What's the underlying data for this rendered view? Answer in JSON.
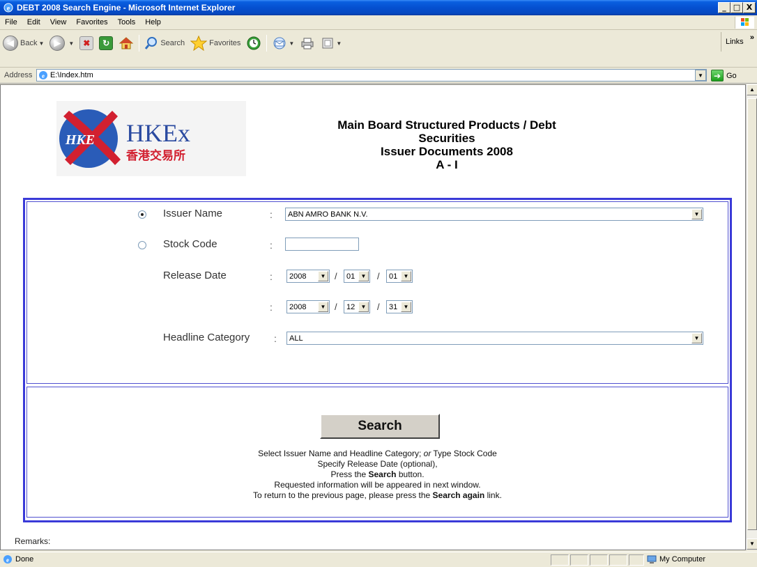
{
  "window": {
    "title": "DEBT 2008 Search Engine - Microsoft Internet Explorer",
    "minimize": "_",
    "maximize": "□",
    "close": "X"
  },
  "menu": {
    "items": [
      {
        "label": "File"
      },
      {
        "label": "Edit"
      },
      {
        "label": "View"
      },
      {
        "label": "Favorites"
      },
      {
        "label": "Tools"
      },
      {
        "label": "Help"
      }
    ]
  },
  "toolbar": {
    "back": "Back",
    "search": "Search",
    "favorites": "Favorites",
    "links": "Links",
    "links_chevron": "»"
  },
  "address": {
    "label": "Address",
    "url": "E:\\Index.htm",
    "go": "Go"
  },
  "header": {
    "line1": "Main Board Structured Products / Debt",
    "line2": "Securities",
    "line3": "Issuer Documents 2008",
    "line4": "A - I"
  },
  "logo": {
    "text": "HKEx",
    "circle_text": "HKE",
    "chinese": "香港交易所"
  },
  "form": {
    "issuer_name_label": "Issuer Name",
    "issuer_name_value": "ABN AMRO BANK N.V.",
    "stock_code_label": "Stock Code",
    "stock_code_value": "",
    "release_date_label": "Release Date",
    "colon": ":",
    "slash": "/",
    "from_year": "2008",
    "from_month": "01",
    "from_day": "01",
    "to_year": "2008",
    "to_month": "12",
    "to_day": "31",
    "headline_category_label": "Headline Category",
    "headline_category_value": "ALL"
  },
  "search": {
    "button_label": "Search",
    "line1_a": "Select Issuer Name and Headline Category; ",
    "line1_or": "or",
    "line1_b": " Type Stock Code",
    "line2": "Specify Release Date (optional),",
    "line3_a": "Press the ",
    "line3_bold": "Search",
    "line3_b": " button.",
    "line4": "Requested information will be appeared in next window.",
    "line5_a": "To return to the previous page, please press the ",
    "line5_bold": "Search again",
    "line5_b": " link."
  },
  "remarks": "Remarks:",
  "status": {
    "done": "Done",
    "zone": "My Computer"
  },
  "colors": {
    "frame_border": "#3a3ad8",
    "titlebar": "#0550d0",
    "logo_red": "#d22030",
    "logo_blue": "#2a5cb8"
  }
}
